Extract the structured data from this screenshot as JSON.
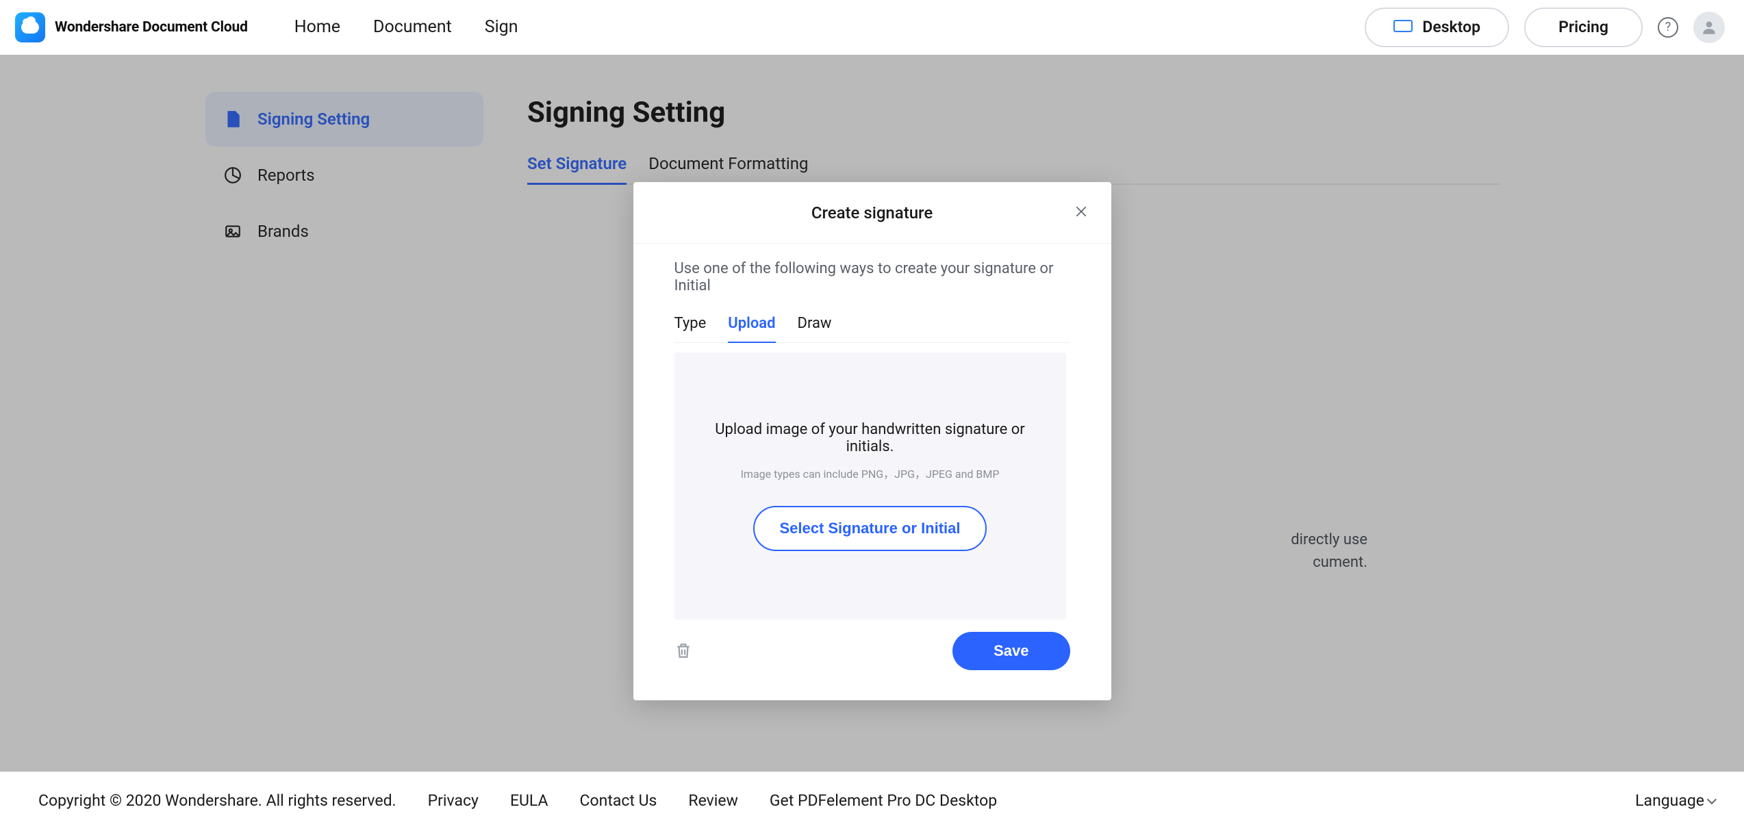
{
  "brand": {
    "name": "Wondershare Document Cloud"
  },
  "nav": {
    "home": "Home",
    "document": "Document",
    "sign": "Sign"
  },
  "header_actions": {
    "desktop": "Desktop",
    "pricing": "Pricing"
  },
  "sidebar": {
    "items": [
      {
        "label": "Signing Setting"
      },
      {
        "label": "Reports"
      },
      {
        "label": "Brands"
      }
    ]
  },
  "page": {
    "title": "Signing Setting",
    "tabs": {
      "set_signature": "Set Signature",
      "document_formatting": "Document Formatting"
    }
  },
  "modal": {
    "title": "Create signature",
    "description": "Use one of the following ways to create your signature or Initial",
    "tabs": {
      "type": "Type",
      "upload": "Upload",
      "draw": "Draw"
    },
    "upload": {
      "main": "Upload image of your handwritten signature or initials.",
      "hint": "Image types can include PNG，JPG，JPEG and BMP",
      "select_button": "Select Signature or Initial"
    },
    "save": "Save"
  },
  "background_peek": {
    "line1": "directly use",
    "line2": "cument."
  },
  "footer": {
    "copyright": "Copyright © 2020 Wondershare. All rights reserved.",
    "links": {
      "privacy": "Privacy",
      "eula": "EULA",
      "contact": "Contact Us",
      "review": "Review",
      "get_desktop": "Get PDFelement Pro DC Desktop"
    },
    "language": "Language"
  }
}
